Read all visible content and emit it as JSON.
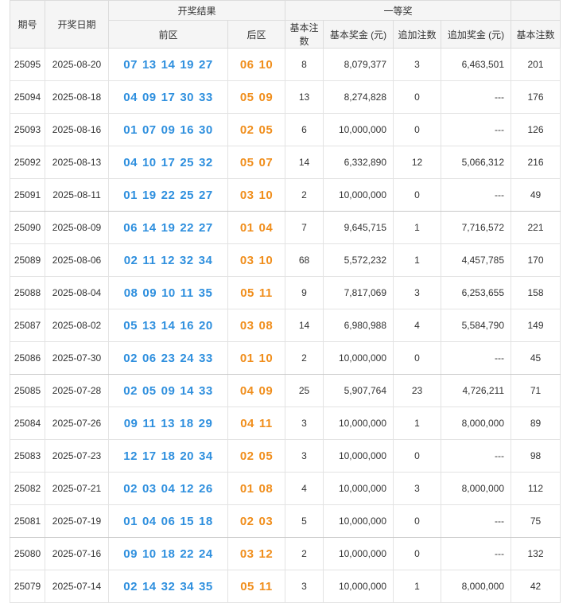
{
  "colors": {
    "front_ball": "#2e8fde",
    "back_ball": "#f08e1c",
    "header_bg": "#f5f5f5"
  },
  "header": {
    "issue": "期号",
    "date": "开奖日期",
    "result": "开奖结果",
    "front": "前区",
    "back": "后区",
    "first_prize": "一等奖",
    "basic_count": "基本注数",
    "basic_prize": "基本奖金 (元)",
    "extra_count": "追加注数",
    "extra_prize": "追加奖金 (元)",
    "second_basic_count": "基本注数"
  },
  "rows": [
    {
      "issue": "25095",
      "date": "2025-08-20",
      "front": [
        "07",
        "13",
        "14",
        "19",
        "27"
      ],
      "back": [
        "06",
        "10"
      ],
      "basic_count": "8",
      "basic_prize": "8,079,377",
      "extra_count": "3",
      "extra_prize": "6,463,501",
      "second_count": "201"
    },
    {
      "issue": "25094",
      "date": "2025-08-18",
      "front": [
        "04",
        "09",
        "17",
        "30",
        "33"
      ],
      "back": [
        "05",
        "09"
      ],
      "basic_count": "13",
      "basic_prize": "8,274,828",
      "extra_count": "0",
      "extra_prize": "---",
      "second_count": "176"
    },
    {
      "issue": "25093",
      "date": "2025-08-16",
      "front": [
        "01",
        "07",
        "09",
        "16",
        "30"
      ],
      "back": [
        "02",
        "05"
      ],
      "basic_count": "6",
      "basic_prize": "10,000,000",
      "extra_count": "0",
      "extra_prize": "---",
      "second_count": "126"
    },
    {
      "issue": "25092",
      "date": "2025-08-13",
      "front": [
        "04",
        "10",
        "17",
        "25",
        "32"
      ],
      "back": [
        "05",
        "07"
      ],
      "basic_count": "14",
      "basic_prize": "6,332,890",
      "extra_count": "12",
      "extra_prize": "5,066,312",
      "second_count": "216"
    },
    {
      "issue": "25091",
      "date": "2025-08-11",
      "front": [
        "01",
        "19",
        "22",
        "25",
        "27"
      ],
      "back": [
        "03",
        "10"
      ],
      "basic_count": "2",
      "basic_prize": "10,000,000",
      "extra_count": "0",
      "extra_prize": "---",
      "second_count": "49"
    },
    {
      "issue": "25090",
      "date": "2025-08-09",
      "front": [
        "06",
        "14",
        "19",
        "22",
        "27"
      ],
      "back": [
        "01",
        "04"
      ],
      "basic_count": "7",
      "basic_prize": "9,645,715",
      "extra_count": "1",
      "extra_prize": "7,716,572",
      "second_count": "221"
    },
    {
      "issue": "25089",
      "date": "2025-08-06",
      "front": [
        "02",
        "11",
        "12",
        "32",
        "34"
      ],
      "back": [
        "03",
        "10"
      ],
      "basic_count": "68",
      "basic_prize": "5,572,232",
      "extra_count": "1",
      "extra_prize": "4,457,785",
      "second_count": "170"
    },
    {
      "issue": "25088",
      "date": "2025-08-04",
      "front": [
        "08",
        "09",
        "10",
        "11",
        "35"
      ],
      "back": [
        "05",
        "11"
      ],
      "basic_count": "9",
      "basic_prize": "7,817,069",
      "extra_count": "3",
      "extra_prize": "6,253,655",
      "second_count": "158"
    },
    {
      "issue": "25087",
      "date": "2025-08-02",
      "front": [
        "05",
        "13",
        "14",
        "16",
        "20"
      ],
      "back": [
        "03",
        "08"
      ],
      "basic_count": "14",
      "basic_prize": "6,980,988",
      "extra_count": "4",
      "extra_prize": "5,584,790",
      "second_count": "149"
    },
    {
      "issue": "25086",
      "date": "2025-07-30",
      "front": [
        "02",
        "06",
        "23",
        "24",
        "33"
      ],
      "back": [
        "01",
        "10"
      ],
      "basic_count": "2",
      "basic_prize": "10,000,000",
      "extra_count": "0",
      "extra_prize": "---",
      "second_count": "45"
    },
    {
      "issue": "25085",
      "date": "2025-07-28",
      "front": [
        "02",
        "05",
        "09",
        "14",
        "33"
      ],
      "back": [
        "04",
        "09"
      ],
      "basic_count": "25",
      "basic_prize": "5,907,764",
      "extra_count": "23",
      "extra_prize": "4,726,211",
      "second_count": "71"
    },
    {
      "issue": "25084",
      "date": "2025-07-26",
      "front": [
        "09",
        "11",
        "13",
        "18",
        "29"
      ],
      "back": [
        "04",
        "11"
      ],
      "basic_count": "3",
      "basic_prize": "10,000,000",
      "extra_count": "1",
      "extra_prize": "8,000,000",
      "second_count": "89"
    },
    {
      "issue": "25083",
      "date": "2025-07-23",
      "front": [
        "12",
        "17",
        "18",
        "20",
        "34"
      ],
      "back": [
        "02",
        "05"
      ],
      "basic_count": "3",
      "basic_prize": "10,000,000",
      "extra_count": "0",
      "extra_prize": "---",
      "second_count": "98"
    },
    {
      "issue": "25082",
      "date": "2025-07-21",
      "front": [
        "02",
        "03",
        "04",
        "12",
        "26"
      ],
      "back": [
        "01",
        "08"
      ],
      "basic_count": "4",
      "basic_prize": "10,000,000",
      "extra_count": "3",
      "extra_prize": "8,000,000",
      "second_count": "112"
    },
    {
      "issue": "25081",
      "date": "2025-07-19",
      "front": [
        "01",
        "04",
        "06",
        "15",
        "18"
      ],
      "back": [
        "02",
        "03"
      ],
      "basic_count": "5",
      "basic_prize": "10,000,000",
      "extra_count": "0",
      "extra_prize": "---",
      "second_count": "75"
    },
    {
      "issue": "25080",
      "date": "2025-07-16",
      "front": [
        "09",
        "10",
        "18",
        "22",
        "24"
      ],
      "back": [
        "03",
        "12"
      ],
      "basic_count": "2",
      "basic_prize": "10,000,000",
      "extra_count": "0",
      "extra_prize": "---",
      "second_count": "132"
    },
    {
      "issue": "25079",
      "date": "2025-07-14",
      "front": [
        "02",
        "14",
        "32",
        "34",
        "35"
      ],
      "back": [
        "05",
        "11"
      ],
      "basic_count": "3",
      "basic_prize": "10,000,000",
      "extra_count": "1",
      "extra_prize": "8,000,000",
      "second_count": "42"
    }
  ]
}
